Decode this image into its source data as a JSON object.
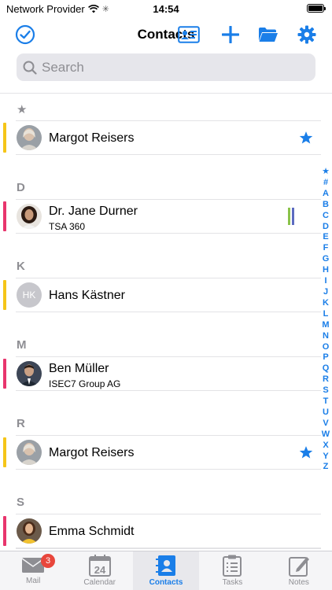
{
  "status": {
    "carrier": "Network Provider",
    "time": "14:54"
  },
  "navbar": {
    "title": "Contacts"
  },
  "search": {
    "placeholder": "Search"
  },
  "sections": [
    {
      "header": "★",
      "contacts": [
        {
          "name": "Margot Reisers",
          "sub": "",
          "bar": "#f5c518",
          "avatar": "photo-grey",
          "favorite": true
        }
      ]
    },
    {
      "header": "D",
      "contacts": [
        {
          "name": "Dr. Jane Durner",
          "sub": "TSA 360",
          "bar": "#e8356d",
          "avatar": "photo-dark-hair",
          "tags": [
            "#8bc34a",
            "#5c6bc0"
          ]
        }
      ]
    },
    {
      "header": "K",
      "contacts": [
        {
          "name": "Hans Kästner",
          "sub": "",
          "bar": "#f5c518",
          "avatar": "initials",
          "initials": "HK"
        }
      ]
    },
    {
      "header": "M",
      "contacts": [
        {
          "name": "Ben Müller",
          "sub": "ISEC7 Group AG",
          "bar": "#e8356d",
          "avatar": "photo-suit"
        }
      ]
    },
    {
      "header": "R",
      "contacts": [
        {
          "name": "Margot Reisers",
          "sub": "",
          "bar": "#f5c518",
          "avatar": "photo-grey",
          "favorite": true
        }
      ]
    },
    {
      "header": "S",
      "contacts": [
        {
          "name": "Emma Schmidt",
          "sub": "",
          "bar": "#e8356d",
          "avatar": "photo-yellow"
        }
      ]
    }
  ],
  "index": [
    "★",
    "#",
    "A",
    "B",
    "C",
    "D",
    "E",
    "F",
    "G",
    "H",
    "I",
    "J",
    "K",
    "L",
    "M",
    "N",
    "O",
    "P",
    "Q",
    "R",
    "S",
    "T",
    "U",
    "V",
    "W",
    "X",
    "Y",
    "Z"
  ],
  "tabs": [
    {
      "label": "Mail",
      "icon": "mail-icon",
      "badge": "3"
    },
    {
      "label": "Calendar",
      "icon": "calendar-icon",
      "day": "24"
    },
    {
      "label": "Contacts",
      "icon": "contacts-icon",
      "active": true
    },
    {
      "label": "Tasks",
      "icon": "tasks-icon"
    },
    {
      "label": "Notes",
      "icon": "notes-icon"
    }
  ],
  "colors": {
    "accent": "#1a7ee8",
    "favorite": "#1a7ee8",
    "yellow_bar": "#f5c518",
    "pink_bar": "#e8356d"
  }
}
